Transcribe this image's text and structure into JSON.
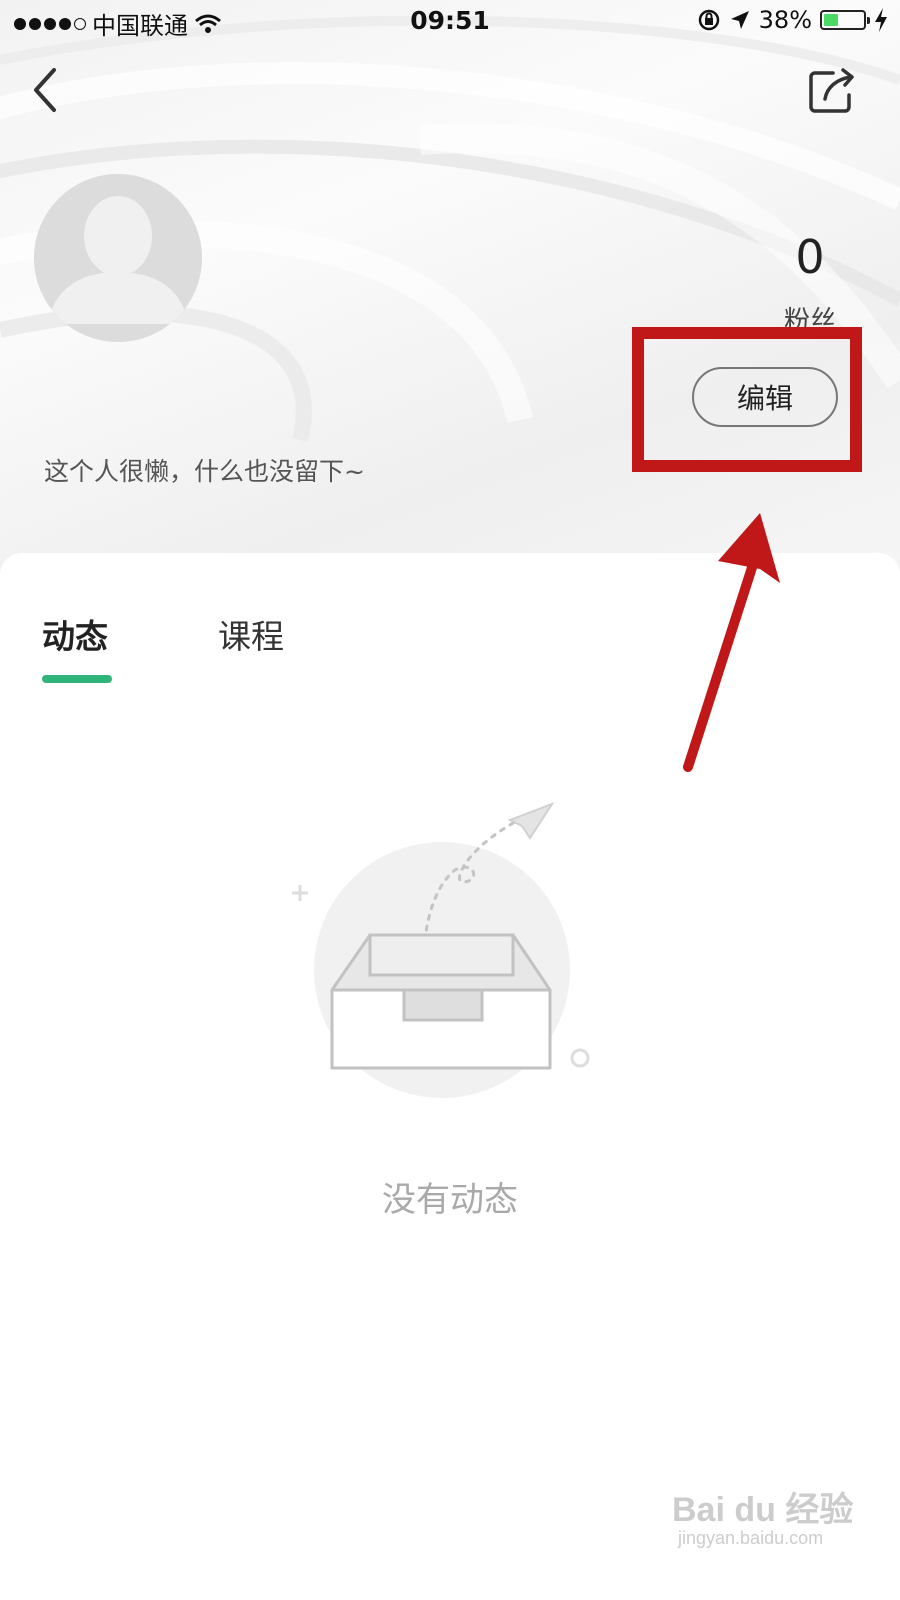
{
  "status_bar": {
    "carrier": "中国联通",
    "time": "09:51",
    "battery_percent": "38%",
    "battery_level": 0.38,
    "icons": [
      "signal-dots-icon",
      "wifi-icon",
      "rotation-lock-icon",
      "location-arrow-icon",
      "battery-icon",
      "charging-bolt-icon"
    ]
  },
  "nav": {
    "back_icon": "chevron-left-icon",
    "share_icon": "share-icon"
  },
  "profile": {
    "avatar_icon": "default-avatar-icon",
    "stats": {
      "value": "0",
      "label": "粉丝"
    },
    "edit_label": "编辑",
    "bio": "这个人很懒，什么也没留下~"
  },
  "tabs": [
    {
      "label": "动态",
      "active": true
    },
    {
      "label": "课程",
      "active": false
    }
  ],
  "accent_color": "#2fb47a",
  "empty_state": {
    "icon": "empty-inbox-paper-plane-icon",
    "text": "没有动态"
  },
  "annotation": {
    "color": "#c01818",
    "elements": [
      "highlight-box",
      "red-arrow"
    ]
  },
  "watermark": {
    "logo": "Bai du 经验",
    "url": "jingyan.baidu.com"
  }
}
